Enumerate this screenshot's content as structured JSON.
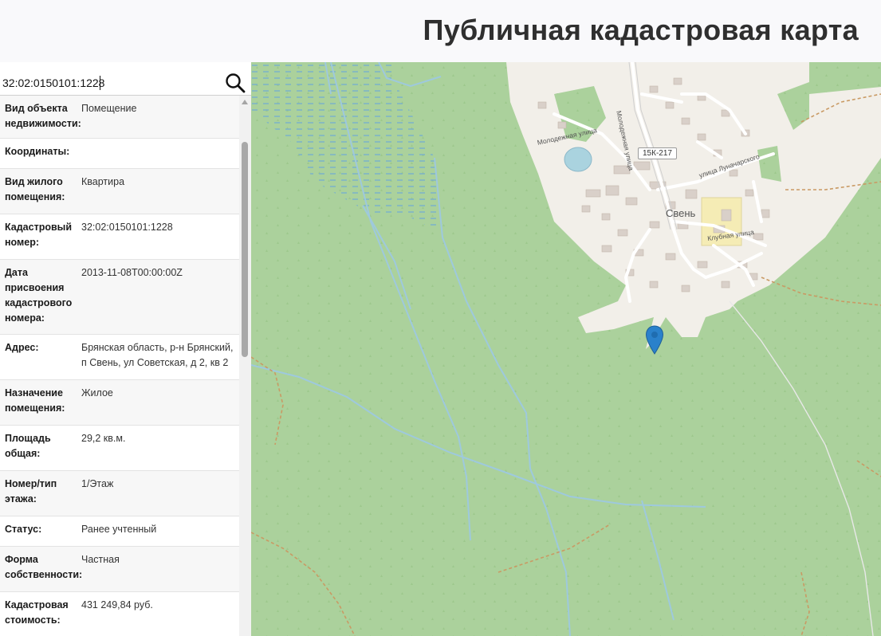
{
  "header": {
    "title": "Публичная кадастровая карта"
  },
  "search": {
    "value": "32:02:0150101:1228",
    "icon": "search-icon"
  },
  "info": {
    "rows": [
      {
        "label": "Вид объекта недвижимости:",
        "value": "Помещение"
      },
      {
        "label": "Координаты:",
        "value": ""
      },
      {
        "label": "Вид жилого помещения:",
        "value": "Квартира"
      },
      {
        "label": "Кадастровый номер:",
        "value": "32:02:0150101:1228"
      },
      {
        "label": "Дата присвоения кадастрового номера:",
        "value": "2013-11-08T00:00:00Z"
      },
      {
        "label": "Адрес:",
        "value": "Брянская область, р-н Брянский, п Свень, ул Советская, д 2, кв 2"
      },
      {
        "label": "Назначение помещения:",
        "value": "Жилое"
      },
      {
        "label": "Площадь общая:",
        "value": "29,2 кв.м."
      },
      {
        "label": "Номер/тип этажа:",
        "value": "1/Этаж"
      },
      {
        "label": "Статус:",
        "value": "Ранее учтенный"
      },
      {
        "label": "Форма собственности:",
        "value": "Частная"
      },
      {
        "label": "Кадастровая стоимость:",
        "value": "431 249,84 руб."
      }
    ]
  },
  "map": {
    "labels": {
      "town": "Свень",
      "road_shield": "15К-217",
      "street_molodezhnaya_1": "Молодежная улица",
      "street_molodezhnaya_2": "Молодежная улица",
      "street_lunacharskogo": "улица Луначарского",
      "street_klubnaya": "Клубная улица"
    },
    "marker_icon": "map-pin-icon",
    "colors": {
      "forest": "#abd19c",
      "residential": "#f2efe9",
      "water": "#aad3df",
      "marker": "#2a81cb",
      "highlight": "#f5ecb5"
    }
  }
}
